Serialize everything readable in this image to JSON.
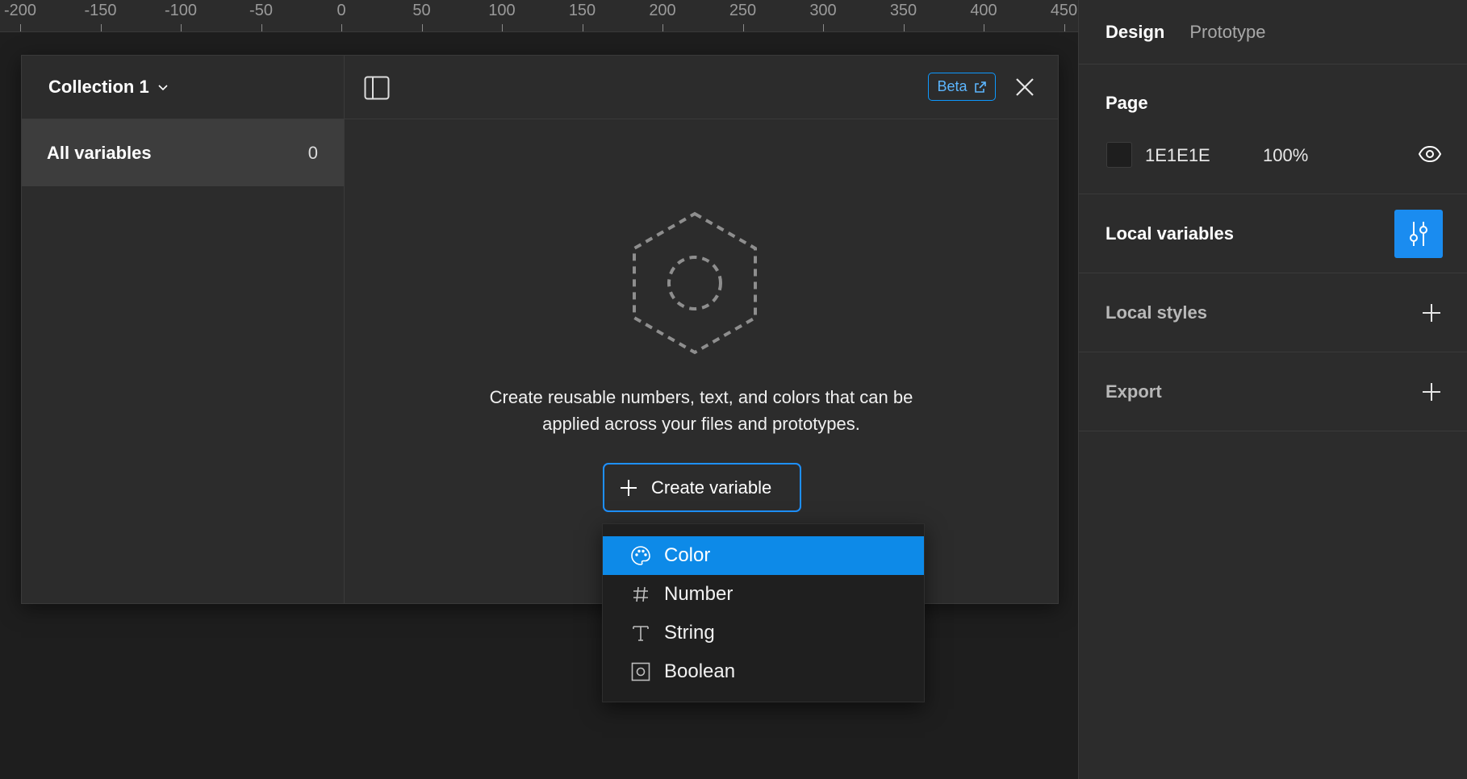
{
  "ruler": {
    "ticks": [
      "-200",
      "-150",
      "-100",
      "-50",
      "0",
      "50",
      "100",
      "150",
      "200",
      "250",
      "300",
      "350",
      "400",
      "450"
    ]
  },
  "modal": {
    "collection_title": "Collection 1",
    "all_variables_label": "All variables",
    "all_variables_count": "0",
    "beta_label": "Beta",
    "empty_text_line1": "Create reusable numbers, text, and colors that can be",
    "empty_text_line2": "applied across your files and prototypes.",
    "create_button_label": "Create variable"
  },
  "dropdown": {
    "items": [
      {
        "label": "Color",
        "icon": "palette-icon",
        "active": true
      },
      {
        "label": "Number",
        "icon": "hash-icon",
        "active": false
      },
      {
        "label": "String",
        "icon": "text-icon",
        "active": false
      },
      {
        "label": "Boolean",
        "icon": "boolean-icon",
        "active": false
      }
    ]
  },
  "right_panel": {
    "tabs": [
      {
        "label": "Design",
        "active": true
      },
      {
        "label": "Prototype",
        "active": false
      }
    ],
    "page": {
      "title": "Page",
      "color_hex": "1E1E1E",
      "opacity": "100%"
    },
    "local_variables_label": "Local variables",
    "local_styles_label": "Local styles",
    "export_label": "Export"
  },
  "colors": {
    "accent": "#0d99ff",
    "panel": "#2c2c2c",
    "canvas": "#1e1e1e"
  }
}
